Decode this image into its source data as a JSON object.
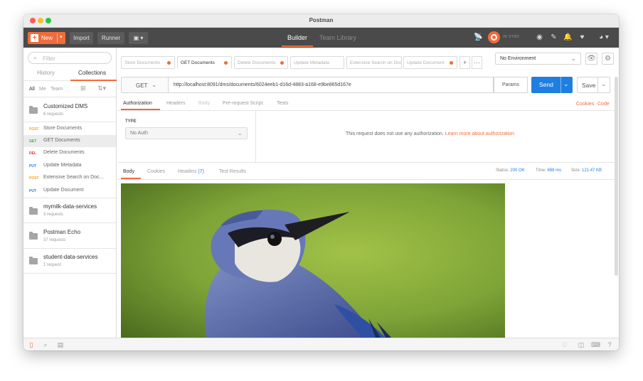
{
  "window": {
    "title": "Postman"
  },
  "colors": {
    "accent": "#f26b3a",
    "send_blue": "#1f7fe0",
    "header_bg": "#4a4a4a"
  },
  "header": {
    "new_label": "New",
    "import_label": "Import",
    "runner_label": "Runner",
    "tabs": [
      "Builder",
      "Team Library"
    ],
    "sync_label": "IN SYNC"
  },
  "sidebar": {
    "filter_placeholder": "Filter",
    "tabs": [
      "History",
      "Collections"
    ],
    "filters": [
      "All",
      "Me",
      "Team"
    ],
    "collections": [
      {
        "name": "Customized DMS",
        "count": "6 requests"
      },
      {
        "name": "mymilk-data-services",
        "count": "3 requests"
      },
      {
        "name": "Postman Echo",
        "count": "37 requests"
      },
      {
        "name": "student-data-services",
        "count": "1 request"
      }
    ],
    "requests": [
      {
        "method": "POST",
        "name": "Store Documents",
        "color": "#f5a623"
      },
      {
        "method": "GET",
        "name": "GET Documents",
        "color": "#3cb044"
      },
      {
        "method": "DEL",
        "name": "Delete Documents",
        "color": "#e5312c"
      },
      {
        "method": "PUT",
        "name": "Update Metadata",
        "color": "#1f7fe0"
      },
      {
        "method": "POST",
        "name": "Extensive Search on Doc...",
        "color": "#f5a623"
      },
      {
        "method": "PUT",
        "name": "Update Document",
        "color": "#1f7fe0"
      }
    ]
  },
  "request_tabs": [
    "Store Documents",
    "GET Documents",
    "Delete Documents",
    "Update Metadata",
    "Extensive Search on Doc",
    "Update Document"
  ],
  "environment": {
    "selected": "No Environment"
  },
  "request": {
    "method": "GET",
    "url": "http://localhost:8091/dms/documents/6024eeb1-d16d-4883-a168-e9be865d167e",
    "params_label": "Params",
    "send_label": "Send",
    "save_label": "Save",
    "subtabs": [
      "Authorization",
      "Headers",
      "Body",
      "Pre-request Script",
      "Tests"
    ],
    "cookies_label": "Cookies",
    "code_label": "Code"
  },
  "auth": {
    "type_label": "TYPE",
    "type_value": "No Auth",
    "message": "This request does not use any authorization.",
    "learn_more": "Learn more about authorization"
  },
  "response": {
    "tabs": [
      "Body",
      "Cookies",
      "Headers",
      "Test Results"
    ],
    "headers_count": "(7)",
    "status_label": "Status:",
    "status_value": "200 OK",
    "time_label": "Time:",
    "time_value": "698 ms",
    "size_label": "Size:",
    "size_value": "121.47 KB"
  }
}
